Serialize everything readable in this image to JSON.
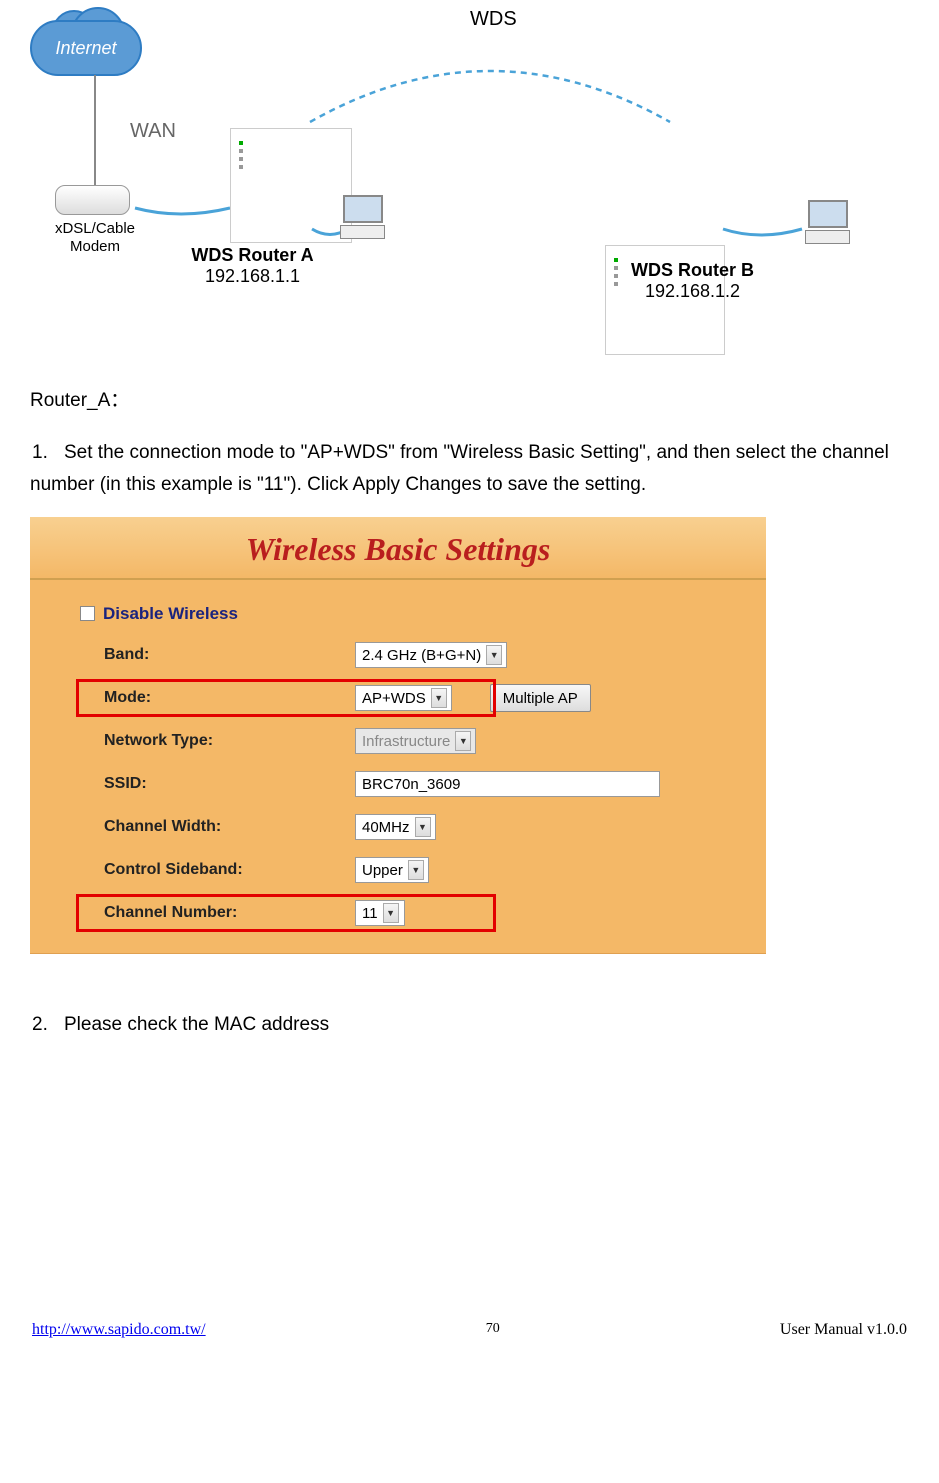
{
  "diagram": {
    "wds": "WDS",
    "internet": "Internet",
    "wan": "WAN",
    "modem": "xDSL/Cable\nModem",
    "router_a_name": "WDS Router A",
    "router_a_ip": "192.168.1.1",
    "router_b_name": "WDS Router B",
    "router_b_ip": "192.168.1.2"
  },
  "section_header": "Router_A：",
  "step1": {
    "num": "1.",
    "text": "Set the connection mode to \"AP+WDS\" from \"Wireless Basic Setting\", and then select the channel number (in this example is \"11\"). Click Apply Changes to save the setting."
  },
  "step2": {
    "num": "2.",
    "text": "Please check the MAC address"
  },
  "panel": {
    "title": "Wireless Basic Settings",
    "disable_label": "Disable Wireless",
    "rows": {
      "band": {
        "label": "Band:",
        "value": "2.4 GHz (B+G+N)"
      },
      "mode": {
        "label": "Mode:",
        "value": "AP+WDS",
        "button": "Multiple AP"
      },
      "network_type": {
        "label": "Network Type:",
        "value": "Infrastructure"
      },
      "ssid": {
        "label": "SSID:",
        "value": "BRC70n_3609"
      },
      "channel_width": {
        "label": "Channel Width:",
        "value": "40MHz"
      },
      "control_sideband": {
        "label": "Control Sideband:",
        "value": "Upper"
      },
      "channel_number": {
        "label": "Channel Number:",
        "value": "11"
      }
    }
  },
  "footer": {
    "url": "http://www.sapido.com.tw/",
    "page": "70",
    "manual": "User Manual v1.0.0"
  }
}
